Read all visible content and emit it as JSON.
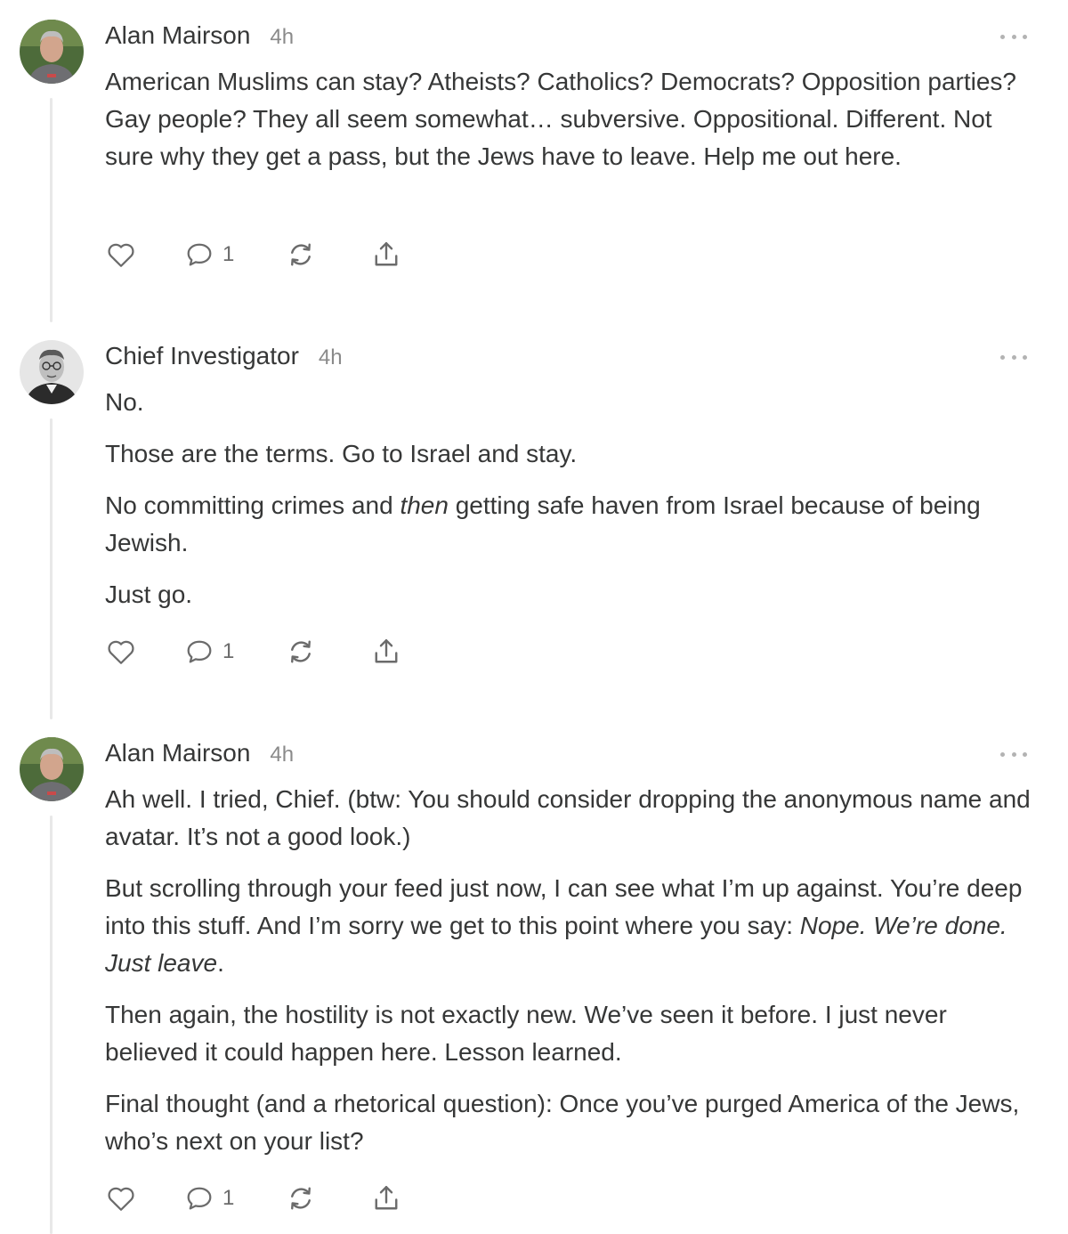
{
  "comments": [
    {
      "author": "Alan Mairson",
      "time": "4h",
      "avatar": "person-photo",
      "paragraphs": [
        [
          "American Muslims can stay? Atheists? Catholics? Democrats? Opposition parties? Gay people? They all seem somewhat… subversive. Oppositional. Different. Not sure why they get a pass, but the Jews have to leave. Help me out here."
        ]
      ],
      "reply_count": "1"
    },
    {
      "author": "Chief Investigator",
      "time": "4h",
      "avatar": "vintage-portrait-photo",
      "paragraphs": [
        [
          "No."
        ],
        [
          "Those are the terms. Go to Israel and stay."
        ],
        [
          "No committing crimes and ",
          "then",
          " getting safe haven from Israel because of being Jewish."
        ],
        [
          "Just go."
        ]
      ],
      "reply_count": "1"
    },
    {
      "author": "Alan Mairson",
      "time": "4h",
      "avatar": "person-photo",
      "paragraphs": [
        [
          "Ah well. I tried, Chief. (btw: You should consider dropping the anonymous name and avatar. It’s not a good look.)"
        ],
        [
          "But scrolling through your feed just now, I can see what I’m up against. You’re deep into this stuff. And I’m sorry we get to this point where you say: ",
          "Nope. We’re done. Just leave",
          "."
        ],
        [
          "Then again, the hostility is not exactly new. We’ve seen it before. I just never believed it could happen here. Lesson learned."
        ],
        [
          "Final thought (and a rhetorical question): Once you’ve purged America of the Jews, who’s next on your list?"
        ]
      ],
      "reply_count": "1"
    }
  ],
  "icons": {
    "like": "heart-icon",
    "reply": "comment-bubble-icon",
    "restack": "restack-icon",
    "share": "share-icon",
    "more": "more-dots-icon"
  }
}
